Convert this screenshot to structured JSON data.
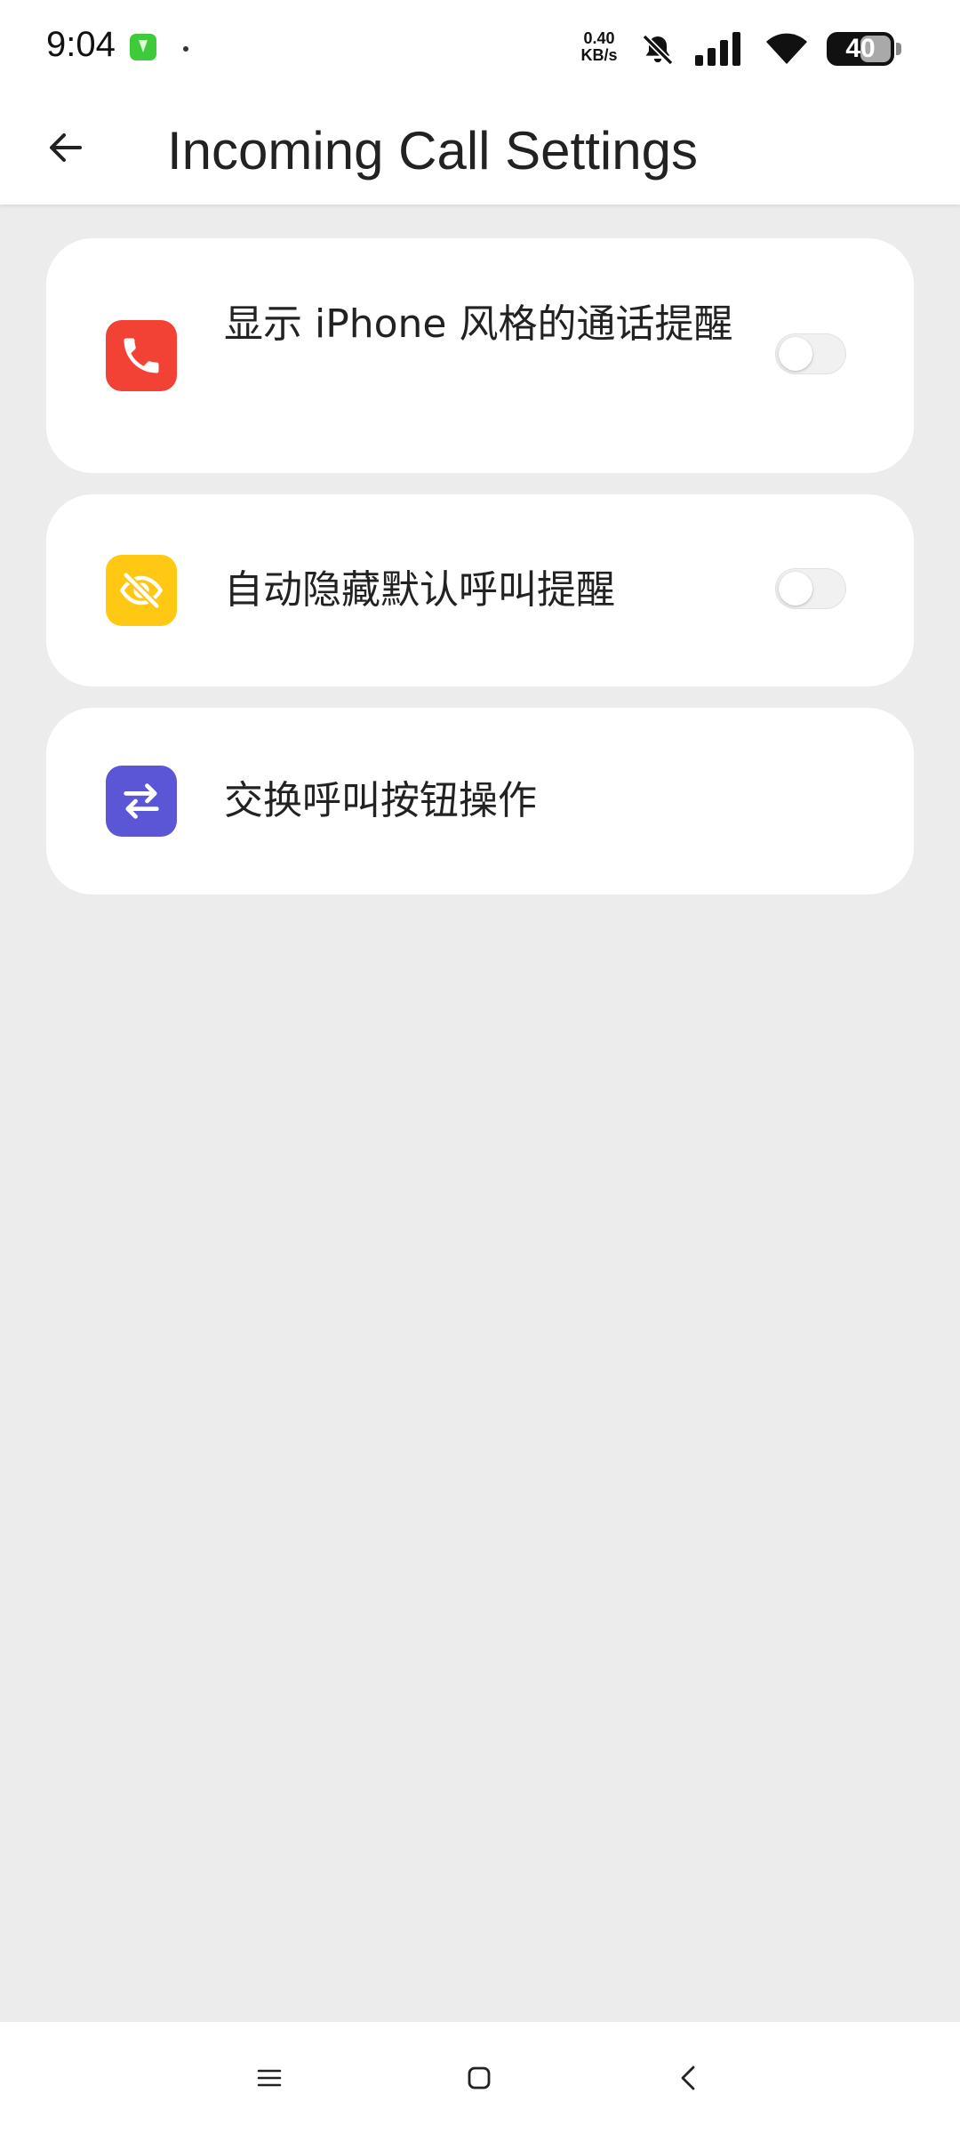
{
  "status_bar": {
    "time": "9:04",
    "net_speed_value": "0.40",
    "net_speed_unit": "KB/s",
    "battery_level": "40",
    "icons": [
      "app-notification-icon",
      "dot-icon",
      "bell-off-icon",
      "signal-icon",
      "wifi-icon",
      "battery-icon"
    ]
  },
  "app_bar": {
    "title": "Incoming Call Settings",
    "back_icon": "arrow-left-icon"
  },
  "settings": [
    {
      "label": "显示 iPhone 风格的通话提醒",
      "icon": "phone-icon",
      "icon_color": "#f24236",
      "toggle": true,
      "enabled": false
    },
    {
      "label": "自动隐藏默认呼叫提醒",
      "icon": "eye-off-icon",
      "icon_color": "#ffc812",
      "toggle": true,
      "enabled": false
    },
    {
      "label": "交换呼叫按钮操作",
      "icon": "swap-arrows-icon",
      "icon_color": "#5b56d6",
      "toggle": false
    }
  ],
  "nav_bar": {
    "icons": [
      "menu-icon",
      "home-square-icon",
      "back-chevron-icon"
    ]
  },
  "colors": {
    "background": "#ececec",
    "card": "#ffffff",
    "text": "#222222"
  }
}
